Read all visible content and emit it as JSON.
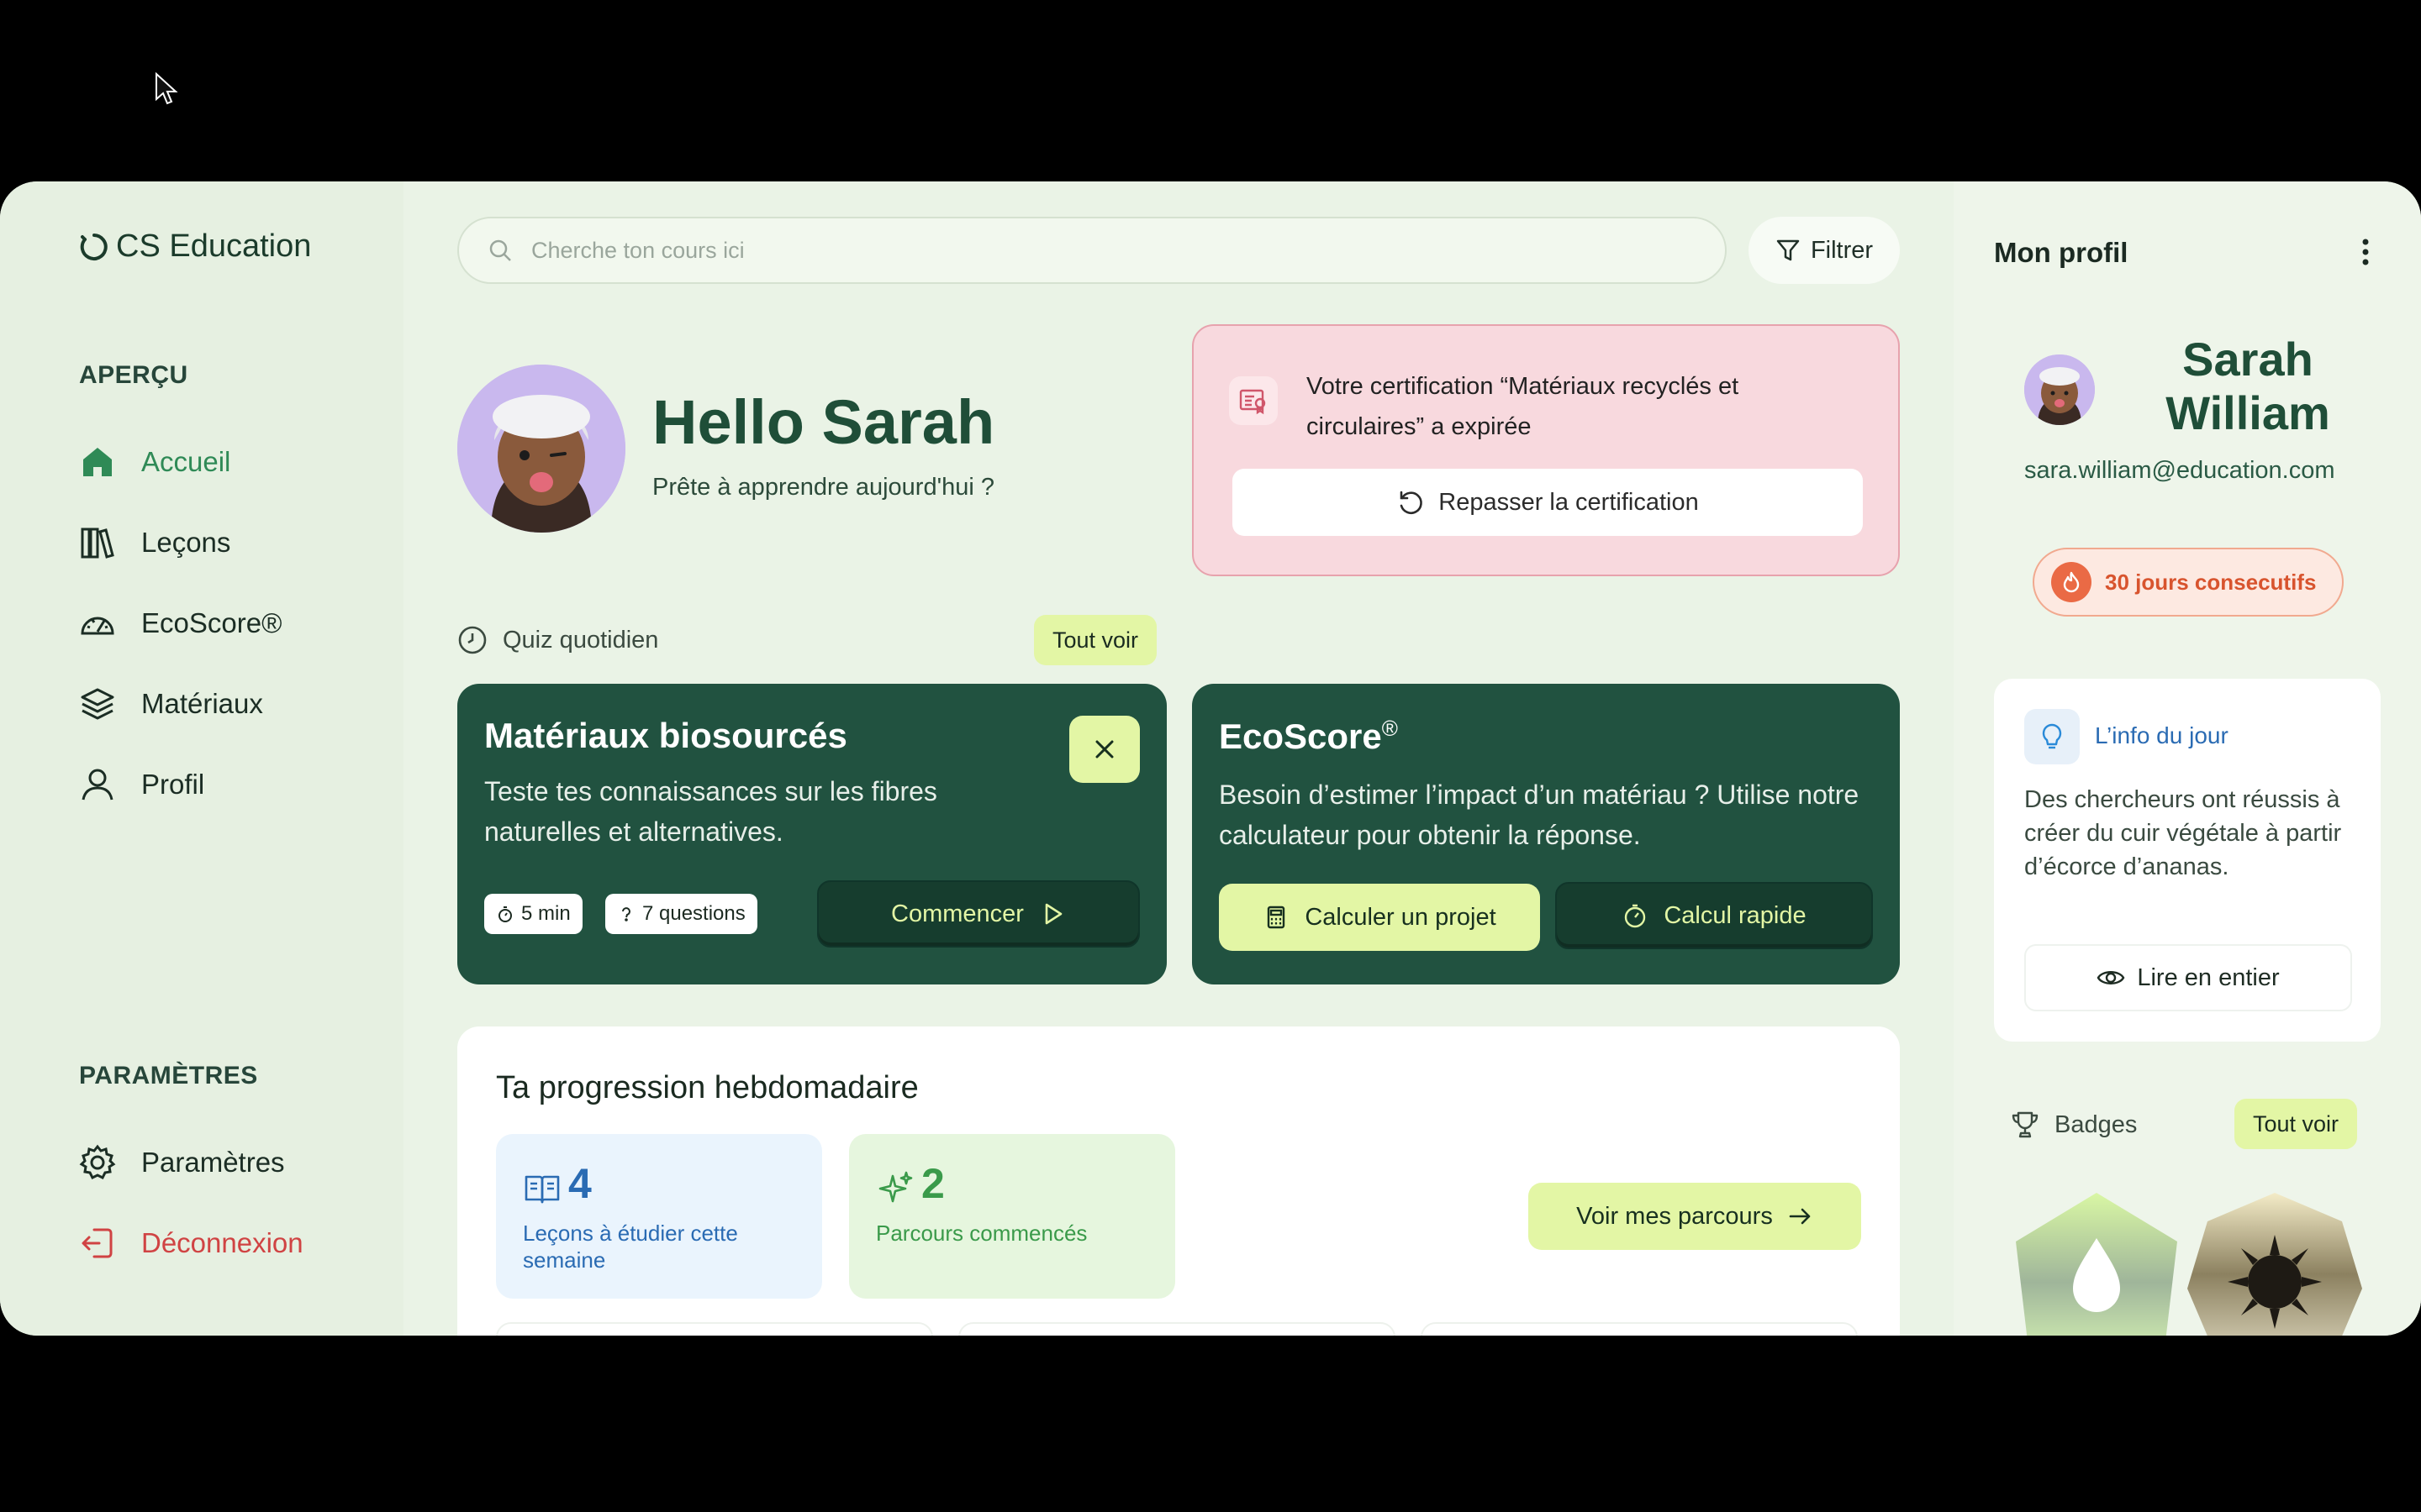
{
  "brand": {
    "name": "CS Education",
    "logo_icon": "ring-logo-icon"
  },
  "sidebar": {
    "overview_title": "APERÇU",
    "items": [
      {
        "label": "Accueil",
        "icon": "home-icon",
        "active": true
      },
      {
        "label": "Leçons",
        "icon": "books-icon"
      },
      {
        "label": "EcoScore®",
        "icon": "gauge-icon"
      },
      {
        "label": "Matériaux",
        "icon": "layers-icon"
      },
      {
        "label": "Profil",
        "icon": "user-icon"
      }
    ],
    "settings_title": "PARAMÈTRES",
    "settings_items": [
      {
        "label": "Paramètres",
        "icon": "gear-icon"
      },
      {
        "label": "Déconnexion",
        "icon": "logout-icon"
      }
    ]
  },
  "search": {
    "placeholder": "Cherche ton cours ici"
  },
  "filter": {
    "label": "Filtrer"
  },
  "greeting": {
    "title": "Hello Sarah",
    "subtitle": "Prête à apprendre aujourd'hui ?"
  },
  "certification": {
    "message": "Votre certification “Matériaux recyclés et circulaires” a expirée",
    "button": "Repasser la certification"
  },
  "quiz": {
    "heading": "Quiz quotidien",
    "see_all": "Tout voir",
    "card": {
      "title": "Matériaux biosourcés",
      "description": "Teste tes connaissances sur les fibres naturelles et alternatives.",
      "duration": "5 min",
      "questions": "7 questions",
      "start": "Commencer"
    }
  },
  "ecoscore": {
    "title": "EcoScore",
    "title_sup": "®",
    "description": "Besoin d’estimer l’impact d’un matériau ? Utilise notre calculateur pour obtenir la réponse.",
    "calc_project": "Calculer un projet",
    "calc_quick": "Calcul rapide"
  },
  "progress": {
    "title": "Ta progression hebdomadaire",
    "lessons": {
      "value": "4",
      "label": "Leçons à étudier cette semaine"
    },
    "paths": {
      "value": "2",
      "label": "Parcours commencés"
    },
    "cta": "Voir mes parcours"
  },
  "profile": {
    "title": "Mon profil",
    "name": "Sarah William",
    "email": "sara.william@education.com",
    "streak": "30 jours consecutifs",
    "tip": {
      "title": "L’info du jour",
      "text": "Des chercheurs ont réussis à créer du cuir végétale à partir d’écorce d’ananas.",
      "button": "Lire en entier"
    },
    "badges": {
      "title": "Badges",
      "see_all": "Tout voir"
    }
  },
  "colors": {
    "brand_green": "#1f4e38",
    "accent_lime": "#e3f6a5",
    "dark_card": "#215240",
    "alert_pink": "#f8d9de",
    "danger": "#d04343"
  }
}
